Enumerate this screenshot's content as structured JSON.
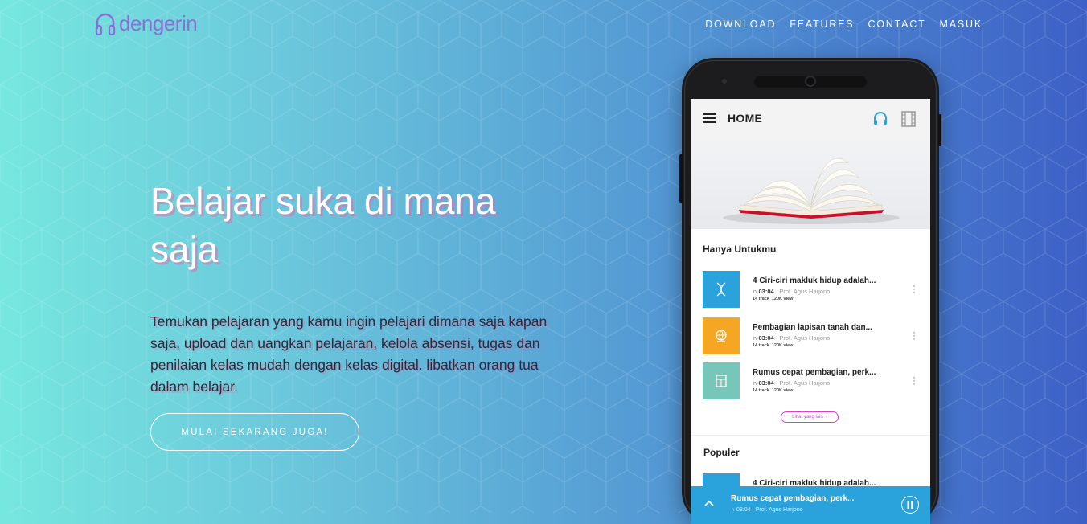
{
  "brand": {
    "name": "dengerin",
    "logo_color": "#8b6fd6"
  },
  "nav": {
    "items": [
      "DOWNLOAD",
      "FEATURES",
      "CONTACT",
      "MASUK"
    ]
  },
  "hero": {
    "title": "Belajar suka di mana saja",
    "description": "Temukan pelajaran yang kamu ingin pelajari dimana saja kapan saja, upload dan uangkan pelajaran, kelola absensi, tugas dan penilaian kelas mudah dengan kelas digital. libatkan orang tua dalam belajar.",
    "cta_label": "MULAI SEKARANG JUGA!"
  },
  "colors": {
    "accent_blue": "#2aa3dd",
    "orange": "#f5a623",
    "teal": "#76c7b9",
    "pink": "#e040c0"
  },
  "app": {
    "header_title": "HOME",
    "icons": [
      "menu-icon",
      "headphones-icon",
      "film-icon"
    ],
    "section_for_you": "Hanya Untukmu",
    "items": [
      {
        "title": "4 Ciri-ciri makluk hidup adalah...",
        "duration": "03:04",
        "author": "Prof. Agus Harjono",
        "tracks": "14 track",
        "views": "120K view",
        "thumb_color": "#2aa3dd",
        "icon": "dna-icon"
      },
      {
        "title": "Pembagian lapisan tanah dan...",
        "duration": "03:04",
        "author": "Prof. Agus Harjono",
        "tracks": "14 track",
        "views": "120K view",
        "thumb_color": "#f5a623",
        "icon": "globe-icon"
      },
      {
        "title": "Rumus cepat pembagian, perk...",
        "duration": "03:04",
        "author": "Prof. Agus Harjono",
        "tracks": "14 track",
        "views": "120K view",
        "thumb_color": "#76c7b9",
        "icon": "calculator-icon"
      }
    ],
    "see_all": "Lihat yang lain",
    "section_popular": "Populer",
    "popular_item_title": "4 Ciri-ciri makluk hidup adalah...",
    "player": {
      "title": "Rumus cepat pembagian, perk...",
      "duration": "03:04",
      "author": "Prof. Agus Harjono"
    }
  }
}
